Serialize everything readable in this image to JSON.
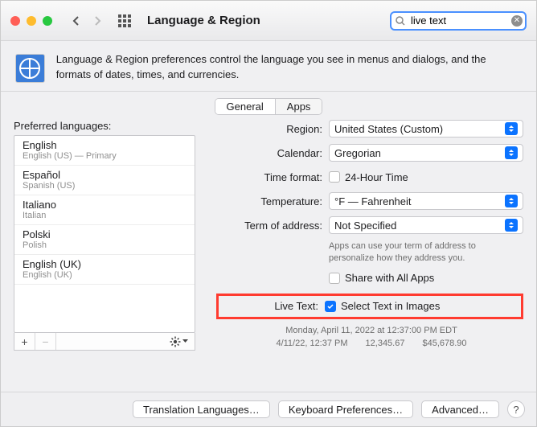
{
  "titlebar": {
    "title": "Language & Region",
    "search_value": "live text"
  },
  "header": {
    "text": "Language & Region preferences control the language you see in menus and dialogs, and the formats of dates, times, and currencies."
  },
  "tabs": {
    "general": "General",
    "apps": "Apps"
  },
  "left": {
    "title": "Preferred languages:"
  },
  "langs": [
    {
      "name": "English",
      "sub": "English (US) — Primary"
    },
    {
      "name": "Español",
      "sub": "Spanish (US)"
    },
    {
      "name": "Italiano",
      "sub": "Italian"
    },
    {
      "name": "Polski",
      "sub": "Polish"
    },
    {
      "name": "English (UK)",
      "sub": "English (UK)"
    }
  ],
  "settings": {
    "region_label": "Region:",
    "region_value": "United States (Custom)",
    "calendar_label": "Calendar:",
    "calendar_value": "Gregorian",
    "time_label": "Time format:",
    "time_value": "24-Hour Time",
    "temp_label": "Temperature:",
    "temp_value": "°F — Fahrenheit",
    "term_label": "Term of address:",
    "term_value": "Not Specified",
    "term_hint": "Apps can use your term of address to personalize how they address you.",
    "share_label": "Share with All Apps",
    "live_label": "Live Text:",
    "live_value": "Select Text in Images"
  },
  "samples": {
    "line1": "Monday, April 11, 2022 at 12:37:00 PM EDT",
    "line2": "4/11/22, 12:37 PM  12,345.67  $45,678.90"
  },
  "footer": {
    "translation": "Translation Languages…",
    "keyboard": "Keyboard Preferences…",
    "advanced": "Advanced…"
  }
}
